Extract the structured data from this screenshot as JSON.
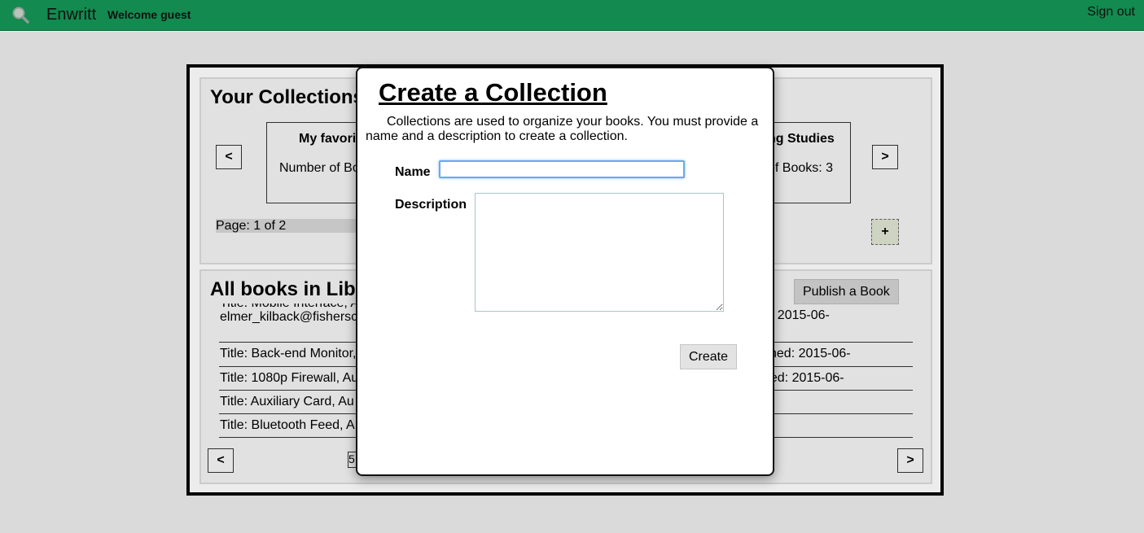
{
  "topbar": {
    "brand": "Enwritt",
    "welcome": "Welcome guest",
    "signout": "Sign out",
    "color": "#138a4f"
  },
  "collections": {
    "title": "Your Collections",
    "prev": "<",
    "next": ">",
    "cards": [
      {
        "title": "My favorit",
        "count": "Number of Bo"
      },
      {
        "title": "ng Studies",
        "count": "of Books: 3"
      }
    ],
    "page": "Page: 1 of 2",
    "add": "+"
  },
  "library": {
    "title": "All books in Libr",
    "publish": "Publish a Book",
    "books": [
      {
        "left": "Title: Mobile Interface, A",
        "left2": "elmer_kilback@fishersc",
        "right": "d: 2015-06-"
      },
      {
        "left": "Title: Back-end Monitor,",
        "right": "shed: 2015-06-"
      },
      {
        "left": "Title: 1080p Firewall, Au",
        "right": "hed: 2015-06-"
      },
      {
        "left": "Title: Auxiliary Card, Au",
        "right": ""
      },
      {
        "left": "Title: Bluetooth Feed, A",
        "right": ""
      }
    ],
    "prev": "<",
    "next": ">",
    "page_box": "5"
  },
  "modal": {
    "title": "Create a Collection",
    "description": "Collections are used to organize your books. You must provide a name and a description to create a collection.",
    "name_label": "Name",
    "name_value": "",
    "description_label": "Description",
    "description_value": "",
    "create": "Create"
  }
}
